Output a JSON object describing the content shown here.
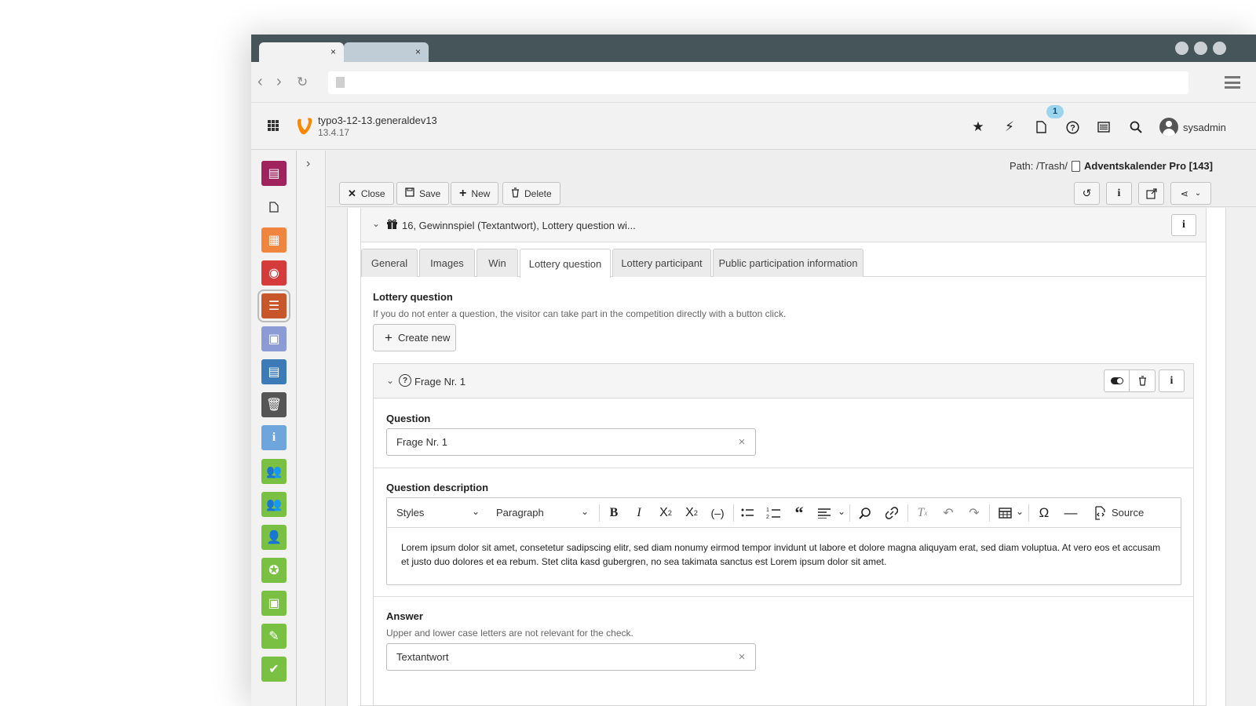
{
  "browser": {
    "tab_close_glyph": "×",
    "nav": {
      "back": "‹",
      "forward": "›",
      "reload": "↻"
    }
  },
  "topbar": {
    "site_name": "typo3-12-13.generaldev13",
    "version": "13.4.17",
    "notification_count": "1",
    "username": "sysadmin",
    "icons": [
      "bookmark-star-icon",
      "flash-icon",
      "open-documents-icon",
      "help-icon",
      "system-information-icon",
      "search-icon"
    ]
  },
  "modules": [
    {
      "name": "dashboard-module-icon",
      "color": "#a0235e"
    },
    {
      "name": "page-module-icon",
      "color": "#f2f2f2"
    },
    {
      "name": "list-module-icon",
      "color": "#f08540"
    },
    {
      "name": "view-module-icon",
      "color": "#d63b3b"
    },
    {
      "name": "records-module-icon",
      "color": "#c8562b"
    },
    {
      "name": "news-module-icon",
      "color": "#8c9ad6"
    },
    {
      "name": "form-module-icon",
      "color": "#3c7bb8"
    },
    {
      "name": "recycler-module-icon",
      "color": "#555555"
    },
    {
      "name": "info-module-icon",
      "color": "#6ea5dd"
    },
    {
      "name": "users-module-icon",
      "color": "#7ac143"
    },
    {
      "name": "groups-module-icon",
      "color": "#7ac143"
    },
    {
      "name": "user-module-icon",
      "color": "#7ac143"
    },
    {
      "name": "medal-module-icon",
      "color": "#7ac143"
    },
    {
      "name": "contact-module-icon",
      "color": "#7ac143"
    },
    {
      "name": "edit-module-icon",
      "color": "#7ac143"
    },
    {
      "name": "check-module-icon",
      "color": "#7ac143"
    }
  ],
  "docheader": {
    "path_label": "Path: /Trash/",
    "record_title": "Adventskalender Pro [143]",
    "buttons": {
      "close": "Close",
      "save": "Save",
      "new": "New",
      "delete": "Delete"
    }
  },
  "record": {
    "header_title": "16, Gewinnspiel (Textantwort), Lottery question wi...",
    "tabs": [
      "General",
      "Images",
      "Win",
      "Lottery question",
      "Lottery participant",
      "Public participation information"
    ],
    "active_tab": "Lottery question",
    "section_title": "Lottery question",
    "section_help": "If you do not enter a question, the visitor can take part in the competition directly with a button click.",
    "create_new_label": "Create new"
  },
  "inline_record": {
    "title": "Frage Nr. 1",
    "question_label": "Question",
    "question_value": "Frage Nr. 1",
    "description_label": "Question description",
    "toolbar": {
      "styles": "Styles",
      "paragraph": "Paragraph",
      "source": "Source"
    },
    "description_text": "Lorem ipsum dolor sit amet, consetetur sadipscing elitr, sed diam nonumy eirmod tempor invidunt ut labore et dolore magna aliquyam erat, sed diam voluptua. At vero eos et accusam et justo duo dolores et ea rebum. Stet clita kasd gubergren, no sea takimata sanctus est Lorem ipsum dolor sit amet.",
    "answer_label": "Answer",
    "answer_help": "Upper and lower case letters are not relevant for the check.",
    "answer_value": "Textantwort"
  },
  "colors": {
    "typo3_orange": "#ff8700",
    "tabstrip": "#46555a",
    "badge": "#9cd4ee"
  }
}
